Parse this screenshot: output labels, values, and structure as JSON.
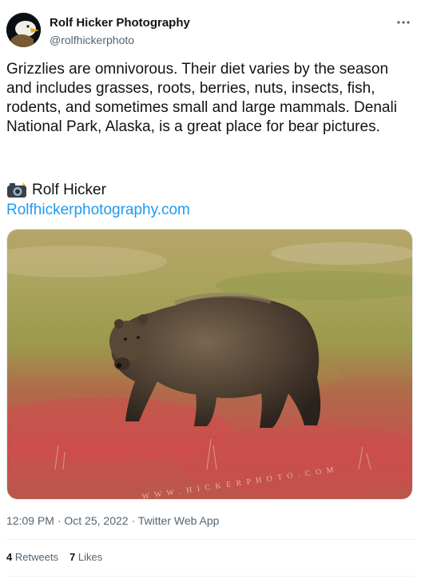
{
  "author": {
    "name": "Rolf Hicker Photography",
    "handle": "@rolfhickerphoto"
  },
  "tweet": {
    "text": "Grizzlies are omnivorous. Their diet varies by the season and includes grasses, roots, berries, nuts, insects, fish, rodents, and sometimes small and large mammals. Denali National Park, Alaska, is a great place for bear pictures.",
    "signature_icon": "camera-with-flash-icon",
    "signature": "Rolf Hicker",
    "link": "Rolfhickerphotography.com",
    "photo_watermark": "W W W . H I C K E R P H O T O . C O M"
  },
  "meta": {
    "time": "12:09 PM",
    "date": "Oct 25, 2022",
    "source": "Twitter Web App",
    "separator": " · "
  },
  "stats": {
    "retweets_count": "4",
    "retweets_label": "Retweets",
    "likes_count": "7",
    "likes_label": "Likes"
  },
  "colors": {
    "link": "#1d9bf0",
    "secondary_text": "#536471",
    "primary_text": "#0f1419"
  }
}
